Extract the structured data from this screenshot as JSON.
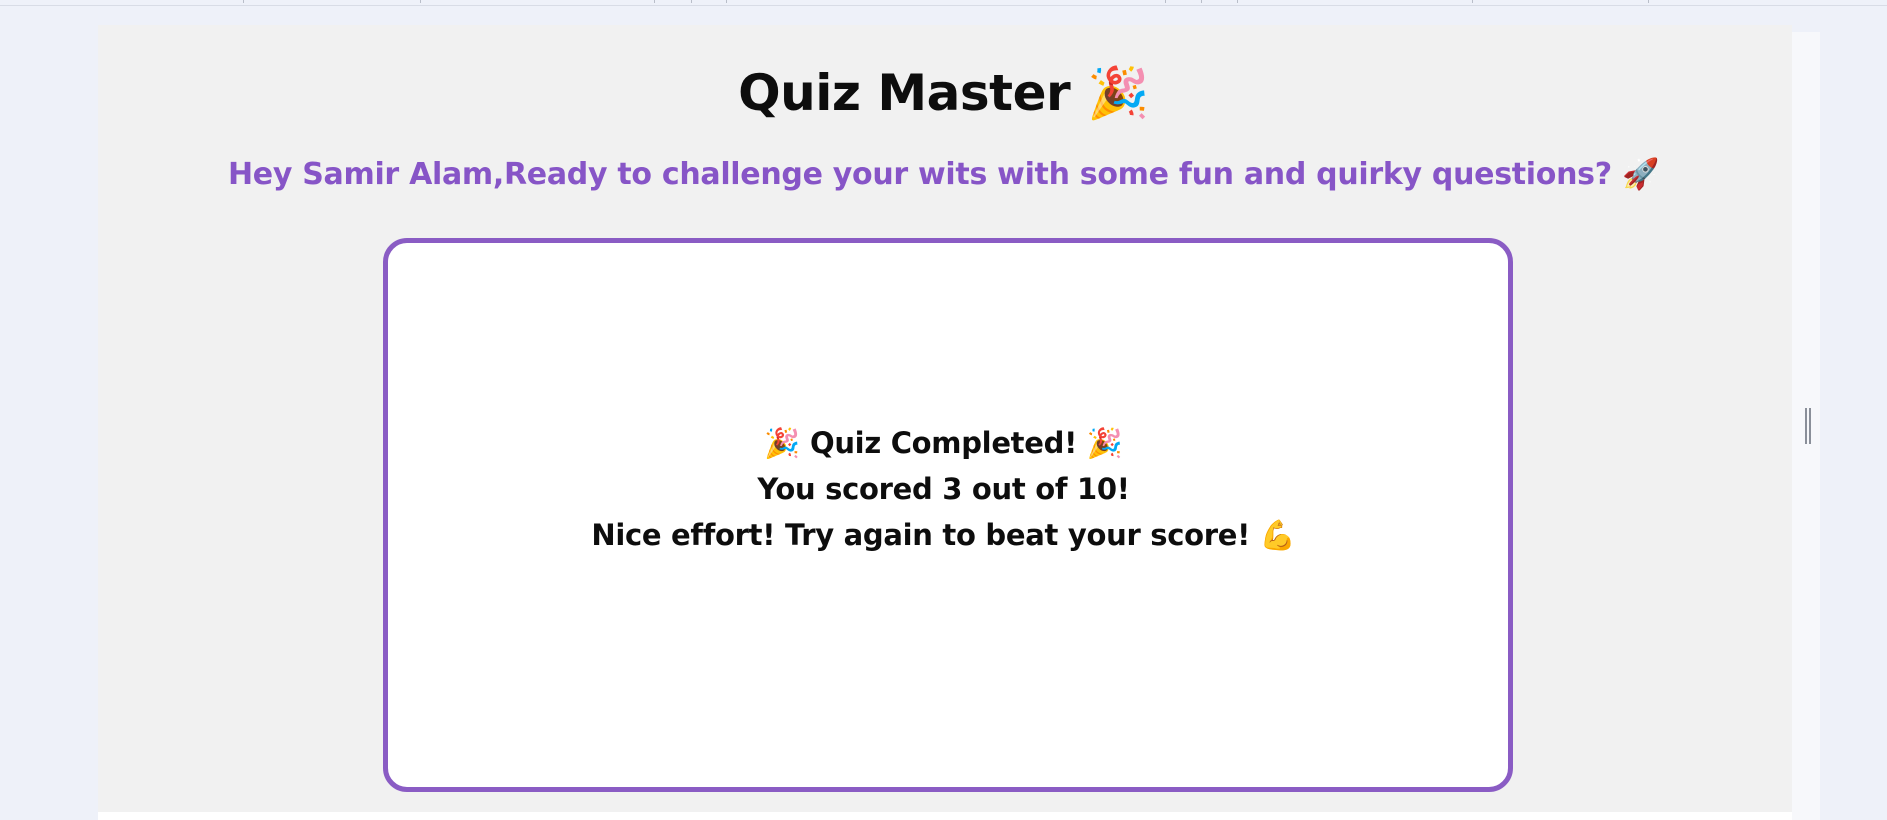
{
  "header": {
    "title": "Quiz Master 🎉",
    "greeting": "Hey Samir Alam,Ready to challenge your wits with some fun and quirky questions? 🚀"
  },
  "result_card": {
    "completed_text": "🎉 Quiz Completed! 🎉",
    "score_text": "You scored 3 out of 10!",
    "message_text": "Nice effort! Try again to beat your score! 💪"
  },
  "colors": {
    "accent": "#8755c7",
    "card_border": "#8a5cc4",
    "page_background": "#f1f1f1",
    "outer_background": "#eef1f9"
  }
}
